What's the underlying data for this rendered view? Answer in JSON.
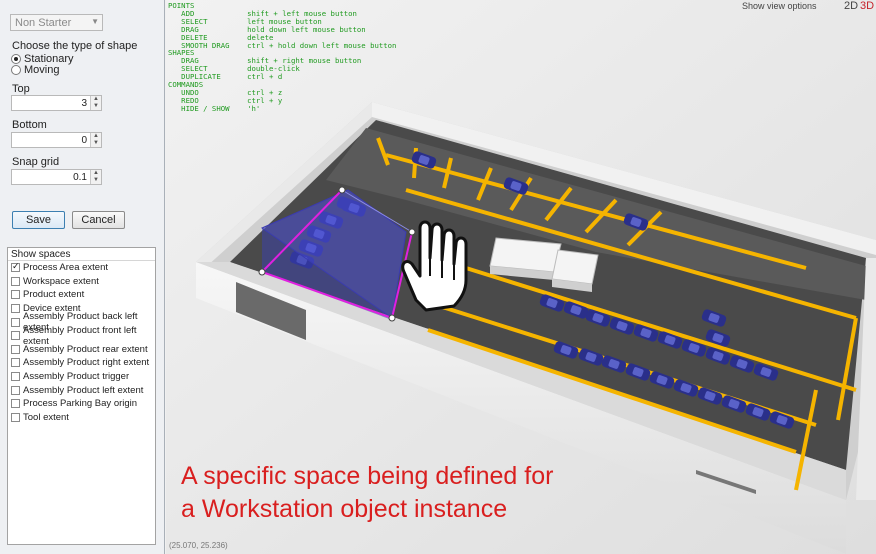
{
  "panel": {
    "dropdown_value": "Non Starter",
    "shape_type_label": "Choose the type of shape",
    "radio_stationary": "Stationary",
    "radio_moving": "Moving",
    "top_label": "Top",
    "top_value": "3",
    "bottom_label": "Bottom",
    "bottom_value": "0",
    "snap_label": "Snap grid",
    "snap_value": "0.1",
    "save": "Save",
    "cancel": "Cancel",
    "spaces_header": "Show spaces",
    "spaces": [
      {
        "label": "Process Area extent",
        "checked": true
      },
      {
        "label": "Workspace extent",
        "checked": false
      },
      {
        "label": "Product extent",
        "checked": false
      },
      {
        "label": "Device extent",
        "checked": false
      },
      {
        "label": "Assembly Product back left extent",
        "checked": false
      },
      {
        "label": "Assembly Product front left extent",
        "checked": false
      },
      {
        "label": "Assembly Product rear extent",
        "checked": false
      },
      {
        "label": "Assembly Product right extent",
        "checked": false
      },
      {
        "label": "Assembly Product trigger",
        "checked": false
      },
      {
        "label": "Assembly Product left extent",
        "checked": false
      },
      {
        "label": "Process Parking Bay origin",
        "checked": false
      },
      {
        "label": "Tool extent",
        "checked": false
      }
    ]
  },
  "viewport": {
    "help_text": "POINTS\n   ADD            shift + left mouse button\n   SELECT         left mouse button\n   DRAG           hold down left mouse button\n   DELETE         delete\n   SMOOTH DRAG    ctrl + hold down left mouse button\nSHAPES\n   DRAG           shift + right mouse button\n   SELECT         double-click\n   DUPLICATE      ctrl + d\nCOMMANDS\n   UNDO           ctrl + z\n   REDO           ctrl + y\n   HIDE / SHOW    'h'",
    "view_options": "Show view options",
    "mode_2d": "2D",
    "mode_3d": "3D",
    "caption_line1": "A specific space being defined for",
    "caption_line2": "a Workstation object instance",
    "coordinates": "(25.070, 25.236)"
  },
  "colors": {
    "help_green": "#1f9a1f",
    "caption_red": "#d91f1f",
    "lane_yellow": "#f5b400",
    "car_blue": "#2a2f8a",
    "selection_magenta": "#e020e0"
  }
}
